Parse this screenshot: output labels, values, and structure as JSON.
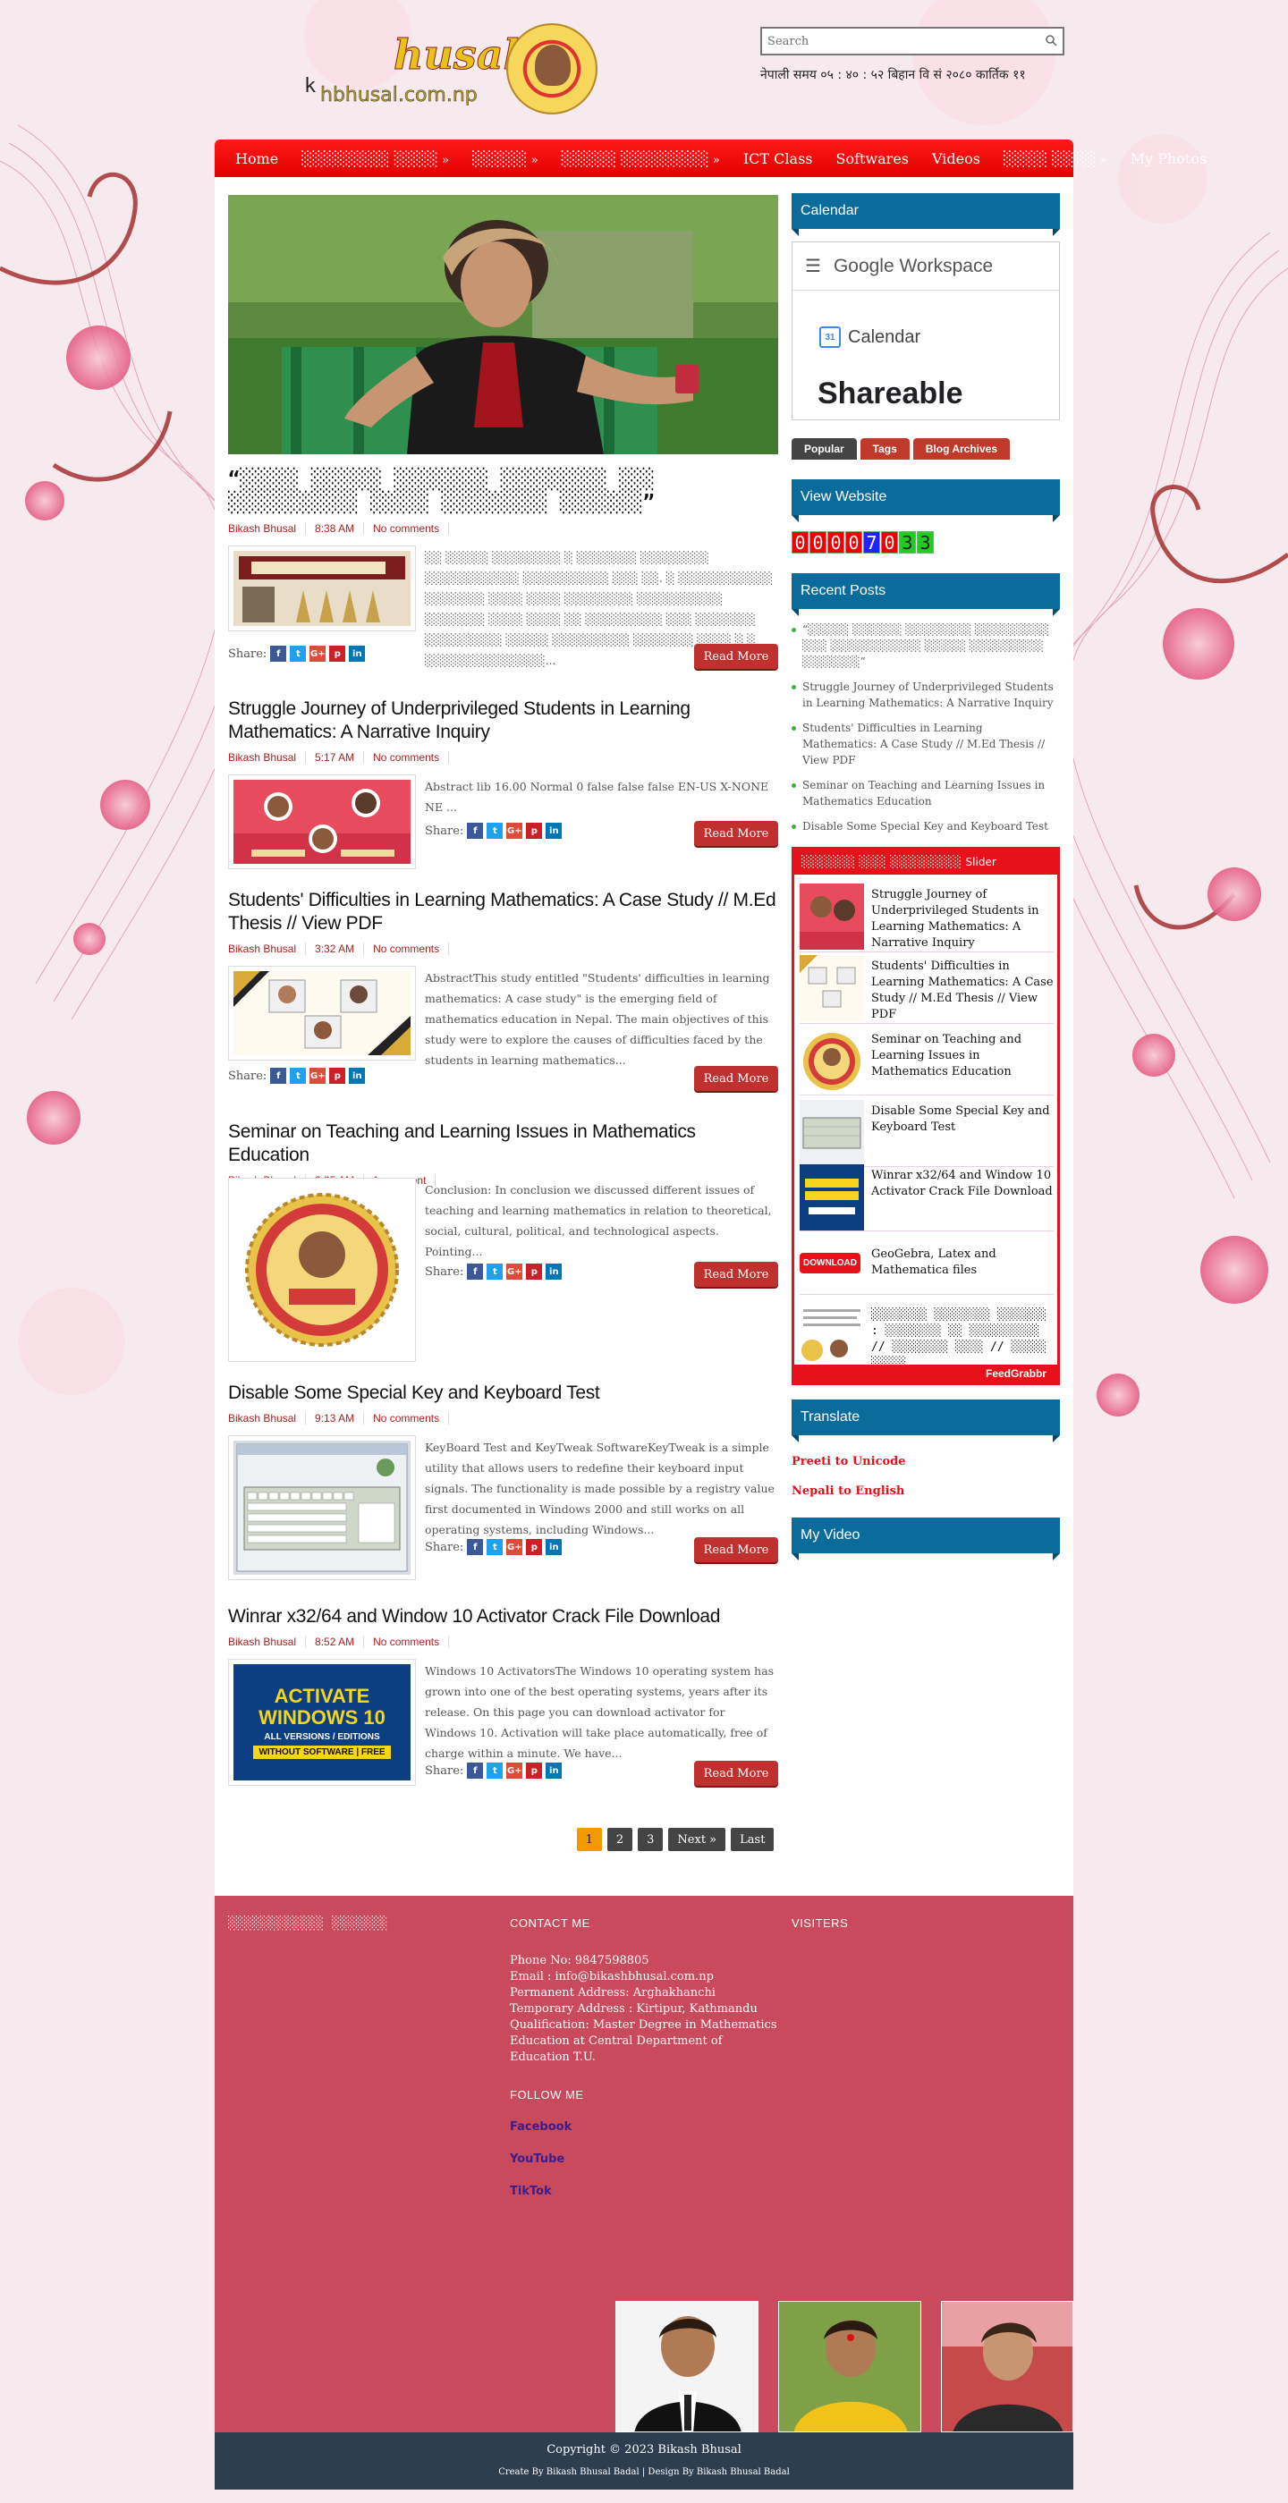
{
  "header": {
    "logo_main": "husal",
    "logo_sub": "hbhusal.com.np",
    "logo_prefix": "k",
    "search_placeholder": "Search",
    "nepali_time": "नेपाली समय ०५ : ४० : ५२ बिहान   वि सं २०८० कार्तिक ११"
  },
  "nav": {
    "items": [
      {
        "label": "Home",
        "dropdown": false
      },
      {
        "label": "░░░░░░░░ ░░░░",
        "dropdown": true
      },
      {
        "label": "░░░░░",
        "dropdown": true
      },
      {
        "label": "░░░░░ ░░░░░░░░",
        "dropdown": true
      },
      {
        "label": "ICT Class",
        "dropdown": false
      },
      {
        "label": "Softwares",
        "dropdown": false
      },
      {
        "label": "Videos",
        "dropdown": false
      },
      {
        "label": "░░░░ ░░░░",
        "dropdown": true
      },
      {
        "label": "My Photos",
        "dropdown": false
      }
    ]
  },
  "posts": [
    {
      "title": "“░░░░░ ░░░░░░ ░░░░░░░░ ░░░░░░░░░ ░░░ ░░░░░░░░░░░ ░░░░░ ░░░░░░░░░ ░░░░░░░”",
      "author": "Bikash Bhusal",
      "time": "8:38 AM",
      "comments": "No comments",
      "excerpt": "  ░░ ░░░░░ ░░░░░░░░ ░      ░░░░░░░ ░░░░░░░░ ░░░░░░░░░░░ ░░░░░░░░░░ ░░░ ░░. ░ ░░░░░░░░░░░ ░░░░░░░ ░░░░ ░░░░ ░░░░░░░░ ░░░░░░░░░░ ░░░░░░░ ░░░░ ░░░░ ░░ ░░░░░░░░░ ░░░ ░░░░░░░ ░░░░░░░░░ ░░░░░ ░░░░░░░░░ ░░░░░░░ ░░░░ ░ ░ ░░░░░░░░░░░░░░...",
      "share_label": "Share:",
      "read_more": "Read More"
    },
    {
      "title": "Struggle Journey of Underprivileged Students in Learning Mathematics: A Narrative Inquiry",
      "author": "Bikash Bhusal",
      "time": "5:17 AM",
      "comments": "No comments",
      "excerpt": " Abstract lib 16.00 Normal 0 false false false EN-US X-NONE NE ...",
      "share_label": "Share:",
      "read_more": "Read More"
    },
    {
      "title": "Students' Difficulties in Learning Mathematics: A Case Study // M.Ed Thesis // View PDF",
      "author": "Bikash Bhusal",
      "time": "3:32 AM",
      "comments": "No comments",
      "excerpt": " AbstractThis study entitled \"Students' difficulties in learning mathematics: A case study\" is the emerging field of mathematics education in Nepal. The main objectives of this study were to explore the causes of difficulties faced by the students in learning mathematics...",
      "share_label": "Share:",
      "read_more": "Read More"
    },
    {
      "title": "Seminar on Teaching and Learning Issues in Mathematics Education",
      "author": "Bikash Bhusal",
      "time": "2:35 AM",
      "comments": "1 comment",
      "excerpt": "       Conclusion:        In conclusion we discussed different issues of teaching and learning mathematics in relation to theoretical, social, cultural, political, and technological aspects. Pointing...",
      "share_label": "Share:",
      "read_more": "Read More"
    },
    {
      "title": "Disable Some Special Key and Keyboard Test",
      "author": "Bikash Bhusal",
      "time": "9:13 AM",
      "comments": "No comments",
      "excerpt": " KeyBoard Test and KeyTweak SoftwareKeyTweak is a simple utility that allows users to redefine their keyboard input signals. The functionality is made possible by a registry value first documented in Windows 2000 and still works on all operating systems, including Windows...",
      "share_label": "Share:",
      "read_more": "Read More"
    },
    {
      "title": "Winrar x32/64 and Window 10 Activator Crack File Download",
      "author": "Bikash Bhusal",
      "time": "8:52 AM",
      "comments": "No comments",
      "excerpt": "Windows 10 ActivatorsThe Windows 10 operating system has grown into one of the best operating systems, years after its release. On this page you can download activator for Windows 10. Activation will take place automatically, free of charge within a minute. We have...",
      "share_label": "Share:",
      "read_more": "Read More",
      "thumb_text": [
        "ACTIVATE",
        "WINDOWS 10",
        "ALL VERSIONS / EDITIONS",
        "WITHOUT SOFTWARE | FREE"
      ]
    }
  ],
  "pager": {
    "pages": [
      "1",
      "2",
      "3"
    ],
    "next": "Next »",
    "last": "Last",
    "active": "1"
  },
  "sidebar": {
    "calendar_title": "Calendar",
    "calendar_brand": "Google Workspace",
    "calendar_label": "Calendar",
    "calendar_day": "31",
    "calendar_shareable": "Shareable",
    "tabs": [
      "Popular",
      "Tags",
      "Blog Archives"
    ],
    "view_title": "View Website",
    "counter": [
      "0",
      "0",
      "0",
      "0",
      "7",
      "0",
      "3",
      "3"
    ],
    "recent_title": "Recent Posts",
    "recent": [
      "“░░░░░ ░░░░░░ ░░░░░░░░ ░░░░░░░░░ ░░░ ░░░░░░░░░░░ ░░░░░ ░░░░░░░░░ ░░░░░░░”",
      "Struggle Journey of Underprivileged Students in Learning Mathematics: A Narrative Inquiry",
      "Students' Difficulties in Learning Mathematics: A Case Study // M.Ed Thesis // View PDF",
      "Seminar on Teaching and Learning Issues in Mathematics Education",
      "Disable Some Special Key and Keyboard Test"
    ],
    "slider_title": "░░░░░░ ░░░ ░░░░░░░░",
    "slider_suffix": "Slider",
    "slider_items": [
      "Struggle Journey of Underprivileged Students in Learning Mathematics: A Narrative Inquiry",
      "Students' Difficulties in Learning Mathematics: A Case Study // M.Ed Thesis // View PDF",
      "Seminar on Teaching and Learning Issues in Mathematics Education",
      "Disable Some Special Key and Keyboard Test",
      "Winrar x32/64 and Window 10 Activator Crack File Download",
      "GeoGebra, Latex and Mathematica files",
      "░░░░░░░░ ░░░░░░░░ ░░░░░░░ : ░░░░░░░░ ░░ ░░░░░░░░░░ // ░░░░░░░░ ░░░░ // ░░░░░ ░░░░░"
    ],
    "download_label": "DOWNLOAD",
    "feedgrabbr": "FeedGrabbr",
    "translate_title": "Translate",
    "translate_links": [
      "Preeti to Unicode",
      "Nepali to English"
    ],
    "video_title": "My Video"
  },
  "footer": {
    "col1_title": "░░░░░░░░░░░░ ░░░░░░░",
    "contact_title": "CONTACT ME",
    "contact_lines": [
      "Phone No: 9847598805",
      "Email : info@bikashbhusal.com.np",
      "Permanent Address: Arghakhanchi",
      "Temporary Address : Kirtipur, Kathmandu",
      "Qualification: Master Degree in Mathematics Education at Central Department of Education T.U."
    ],
    "follow_title": "FOLLOW ME",
    "follow_links": [
      "Facebook",
      "YouTube",
      "TikTok"
    ],
    "visitors_title": "VISITERS",
    "copyright": "Copyright © 2023 Bikash Bhusal",
    "credits": "Create By Bikash Bhusal Badal | Design By Bikash Bhusal Badal"
  }
}
